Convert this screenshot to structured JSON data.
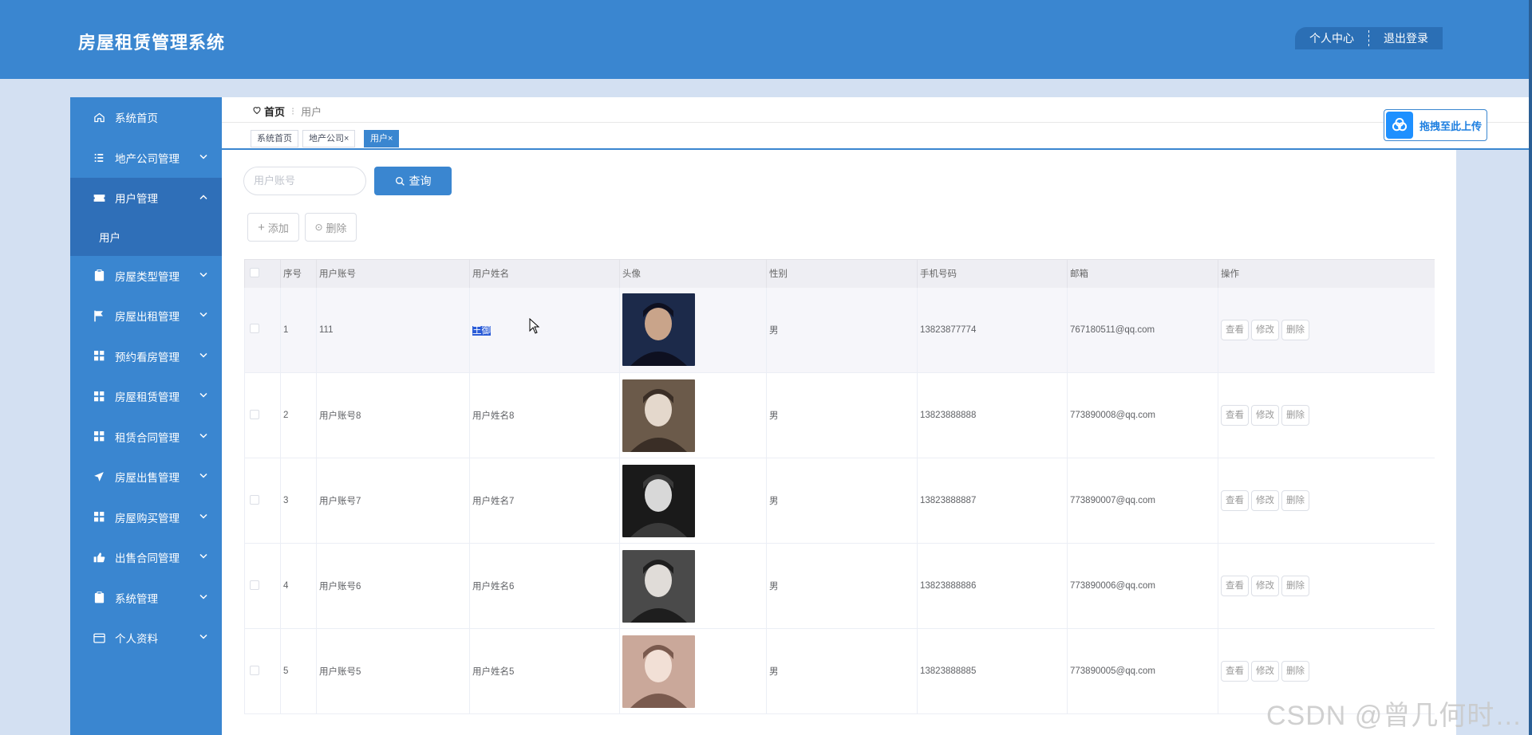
{
  "header": {
    "title": "房屋租赁管理系统",
    "personal_center": "个人中心",
    "logout": "退出登录"
  },
  "sidebar": {
    "items": [
      {
        "label": "系统首页",
        "icon": "home-icon",
        "arrow": ""
      },
      {
        "label": "地产公司管理",
        "icon": "list-icon",
        "arrow": "chevron-down"
      },
      {
        "label": "用户管理",
        "icon": "ticket-icon",
        "arrow": "chevron-up",
        "active": true
      },
      {
        "label": "房屋类型管理",
        "icon": "clipboard-icon",
        "arrow": "chevron-down"
      },
      {
        "label": "房屋出租管理",
        "icon": "flag-icon",
        "arrow": "chevron-down"
      },
      {
        "label": "预约看房管理",
        "icon": "grid-icon",
        "arrow": "chevron-down"
      },
      {
        "label": "房屋租赁管理",
        "icon": "grid-icon",
        "arrow": "chevron-down"
      },
      {
        "label": "租赁合同管理",
        "icon": "grid-icon",
        "arrow": "chevron-down"
      },
      {
        "label": "房屋出售管理",
        "icon": "send-icon",
        "arrow": "chevron-down"
      },
      {
        "label": "房屋购买管理",
        "icon": "grid-icon",
        "arrow": "chevron-down"
      },
      {
        "label": "出售合同管理",
        "icon": "thumb-icon",
        "arrow": "chevron-down"
      },
      {
        "label": "系统管理",
        "icon": "clipboard-icon",
        "arrow": "chevron-down"
      },
      {
        "label": "个人资料",
        "icon": "card-icon",
        "arrow": "chevron-down"
      }
    ],
    "sub_item": "用户"
  },
  "breadcrumb": {
    "home": "首页",
    "current": "用户"
  },
  "tabs": [
    {
      "label": "系统首页",
      "closable": false
    },
    {
      "label": "地产公司",
      "closable": true
    },
    {
      "label": "用户",
      "closable": true,
      "active": true
    }
  ],
  "upload": {
    "label": "拖拽至此上传"
  },
  "search": {
    "placeholder": "用户账号",
    "button": "查询"
  },
  "actions": {
    "add": "添加",
    "delete": "删除"
  },
  "table": {
    "headers": [
      "序号",
      "用户账号",
      "用户姓名",
      "头像",
      "性别",
      "手机号码",
      "邮箱",
      "操作"
    ],
    "op_view": "查看",
    "op_edit": "修改",
    "op_delete": "删除",
    "rows": [
      {
        "no": "1",
        "account": "111",
        "name": "王御",
        "gender": "男",
        "phone": "13823877774",
        "email": "767180511@qq.com",
        "avatar_colors": [
          "#1c2a4a",
          "#c9a48a",
          "#0e1020"
        ]
      },
      {
        "no": "2",
        "account": "用户账号8",
        "name": "用户姓名8",
        "gender": "男",
        "phone": "13823888888",
        "email": "773890008@qq.com",
        "avatar_colors": [
          "#6b5a4a",
          "#e4d8cc",
          "#3a2e26"
        ]
      },
      {
        "no": "3",
        "account": "用户账号7",
        "name": "用户姓名7",
        "gender": "男",
        "phone": "13823888887",
        "email": "773890007@qq.com",
        "avatar_colors": [
          "#1a1a1a",
          "#d8d8d8",
          "#3a3a3a"
        ]
      },
      {
        "no": "4",
        "account": "用户账号6",
        "name": "用户姓名6",
        "gender": "男",
        "phone": "13823888886",
        "email": "773890006@qq.com",
        "avatar_colors": [
          "#4a4a4a",
          "#e0dcd8",
          "#1e1e1e"
        ]
      },
      {
        "no": "5",
        "account": "用户账号5",
        "name": "用户姓名5",
        "gender": "男",
        "phone": "13823888885",
        "email": "773890005@qq.com",
        "avatar_colors": [
          "#caa89a",
          "#f2e0d6",
          "#7a5a4e"
        ]
      }
    ]
  },
  "watermark": "CSDN @曾几何时…"
}
